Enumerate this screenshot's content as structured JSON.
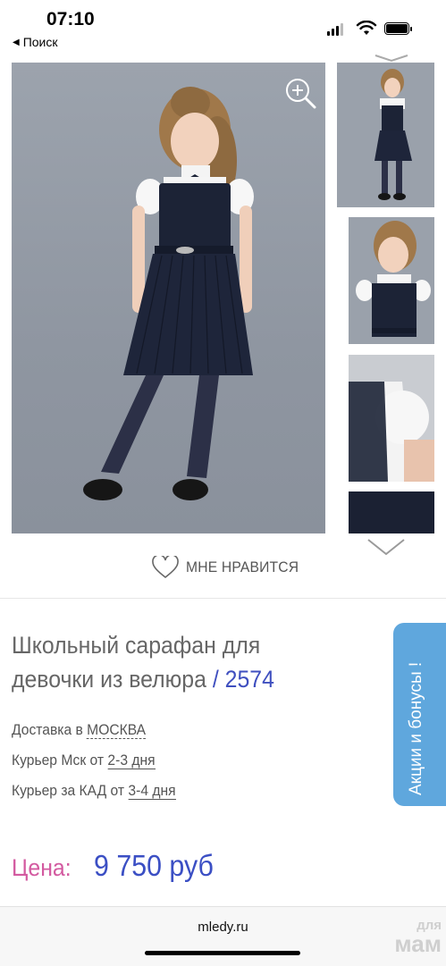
{
  "status_bar": {
    "time": "07:10",
    "back_label": "Поиск"
  },
  "product": {
    "title": "Школьный сарафан для девочки из велюра",
    "sku": "/ 2574",
    "like_label": "МНЕ НРАВИТСЯ",
    "delivery": {
      "prefix": "Доставка в ",
      "city": "МОСКВА",
      "courier_msk_prefix": "Курьер Мск от ",
      "courier_msk_days": "2-3 дня",
      "courier_kad_prefix": "Курьер за КАД от ",
      "courier_kad_days": "3-4 дня"
    },
    "price_label": "Цена:",
    "price_value": "9 750 руб"
  },
  "promo": {
    "label": "Акции и бонусы !"
  },
  "browser": {
    "url": "mledy.ru"
  },
  "watermark": {
    "line1": "для",
    "line2": "мам"
  },
  "colors": {
    "accent": "#3f4fbf",
    "price_label": "#d35aa0",
    "promo_bg": "#5fa7dd"
  }
}
